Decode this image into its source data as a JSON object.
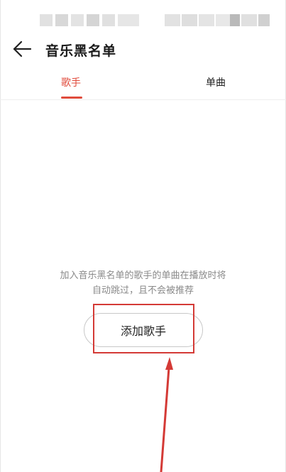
{
  "header": {
    "title": "音乐黑名单",
    "back_icon": "arrow-left-icon"
  },
  "tabs": [
    {
      "label": "歌手",
      "active": true
    },
    {
      "label": "单曲",
      "active": false
    }
  ],
  "empty_state": {
    "message_line1": "加入音乐黑名单的歌手的单曲在播放时将",
    "message_line2": "自动跳过，且不会被推荐",
    "button_label": "添加歌手"
  },
  "colors": {
    "accent": "#e04b3c",
    "annotation": "#d43a36",
    "muted_text": "#8a8a8a"
  }
}
